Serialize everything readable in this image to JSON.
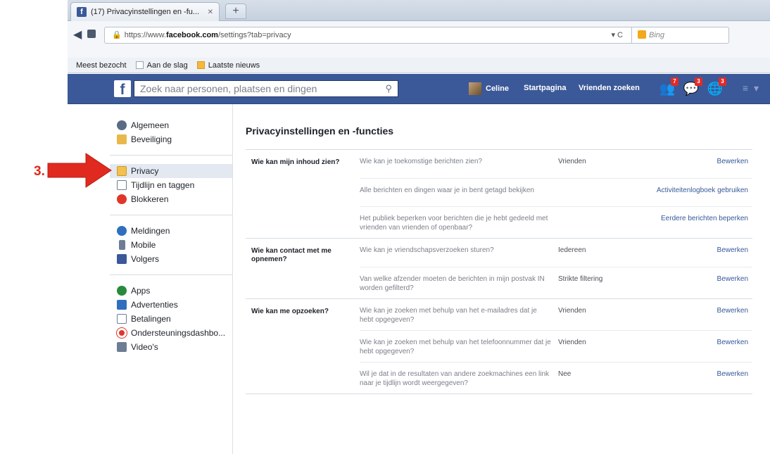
{
  "browser": {
    "tab_title": "(17) Privacyinstellingen en -fu...",
    "url_prefix": "https://www.",
    "url_domain": "facebook.com",
    "url_path": "/settings?tab=privacy",
    "search_engine": "Bing",
    "bookmarks": [
      "Meest bezocht",
      "Aan de slag",
      "Laatste nieuws"
    ]
  },
  "fb": {
    "search_placeholder": "Zoek naar personen, plaatsen en dingen",
    "user_name": "Celine",
    "home_link": "Startpagina",
    "find_friends_link": "Vrienden zoeken",
    "badges": [
      "7",
      "3",
      "3"
    ]
  },
  "sidebar": {
    "groups": [
      [
        "Algemeen",
        "Beveiliging"
      ],
      [
        "Privacy",
        "Tijdlijn en taggen",
        "Blokkeren"
      ],
      [
        "Meldingen",
        "Mobile",
        "Volgers"
      ],
      [
        "Apps",
        "Advertenties",
        "Betalingen",
        "Ondersteuningsdashbo...",
        "Video's"
      ]
    ],
    "active": "Privacy"
  },
  "main": {
    "title": "Privacyinstellingen en -functies",
    "sections": [
      {
        "label": "Wie kan mijn inhoud zien?",
        "rows": [
          {
            "question": "Wie kan je toekomstige berichten zien?",
            "value": "Vrienden",
            "action": "Bewerken"
          },
          {
            "question": "Alle berichten en dingen waar je in bent getagd bekijken",
            "value": "",
            "action": "Activiteitenlogboek gebruiken"
          },
          {
            "question": "Het publiek beperken voor berichten die je hebt gedeeld met vrienden van vrienden of openbaar?",
            "value": "",
            "action": "Eerdere berichten beperken"
          }
        ]
      },
      {
        "label": "Wie kan contact met me opnemen?",
        "rows": [
          {
            "question": "Wie kan je vriendschapsverzoeken sturen?",
            "value": "Iedereen",
            "action": "Bewerken"
          },
          {
            "question": "Van welke afzender moeten de berichten in mijn postvak IN worden gefilterd?",
            "value": "Strikte filtering",
            "action": "Bewerken"
          }
        ]
      },
      {
        "label": "Wie kan me opzoeken?",
        "rows": [
          {
            "question": "Wie kan je zoeken met behulp van het e-mailadres dat je hebt opgegeven?",
            "value": "Vrienden",
            "action": "Bewerken"
          },
          {
            "question": "Wie kan je zoeken met behulp van het telefoonnummer dat je hebt opgegeven?",
            "value": "Vrienden",
            "action": "Bewerken"
          },
          {
            "question": "Wil je dat in de resultaten van andere zoekmachines een link naar je tijdlijn wordt weergegeven?",
            "value": "Nee",
            "action": "Bewerken"
          }
        ]
      }
    ]
  },
  "annotation": {
    "step_label": "3.",
    "color": "#e02a1f"
  },
  "colors": {
    "fb_blue": "#3b5998",
    "link": "#365899"
  }
}
